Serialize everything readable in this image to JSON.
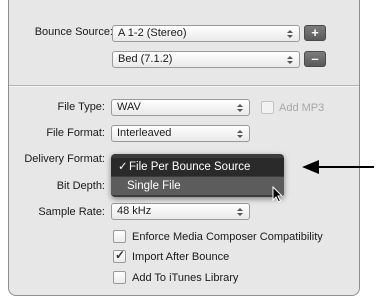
{
  "bounce_source": {
    "label": "Bounce Source:",
    "primary_value": "A 1-2 (Stereo)",
    "secondary_value": "Bed (7.1.2)",
    "add_label": "+",
    "remove_label": "–"
  },
  "file_type": {
    "label": "File Type:",
    "value": "WAV",
    "add_mp3_label": "Add MP3",
    "add_mp3_checked": false
  },
  "file_format": {
    "label": "File Format:",
    "value": "Interleaved"
  },
  "delivery_format": {
    "label": "Delivery Format:",
    "menu": {
      "checkmark": "✓",
      "options": [
        "File Per Bounce Source",
        "Single File"
      ],
      "selected_index": 0,
      "hovered_index": 1
    }
  },
  "bit_depth": {
    "label": "Bit Depth:"
  },
  "sample_rate": {
    "label": "Sample Rate:",
    "value": "48 kHz"
  },
  "options": {
    "enforce_label": "Enforce Media Composer Compatibility",
    "enforce_checked": false,
    "import_label": "Import After Bounce",
    "import_checked": true,
    "import_checkmark": "✓",
    "itunes_label": "Add To iTunes Library",
    "itunes_checked": false
  }
}
